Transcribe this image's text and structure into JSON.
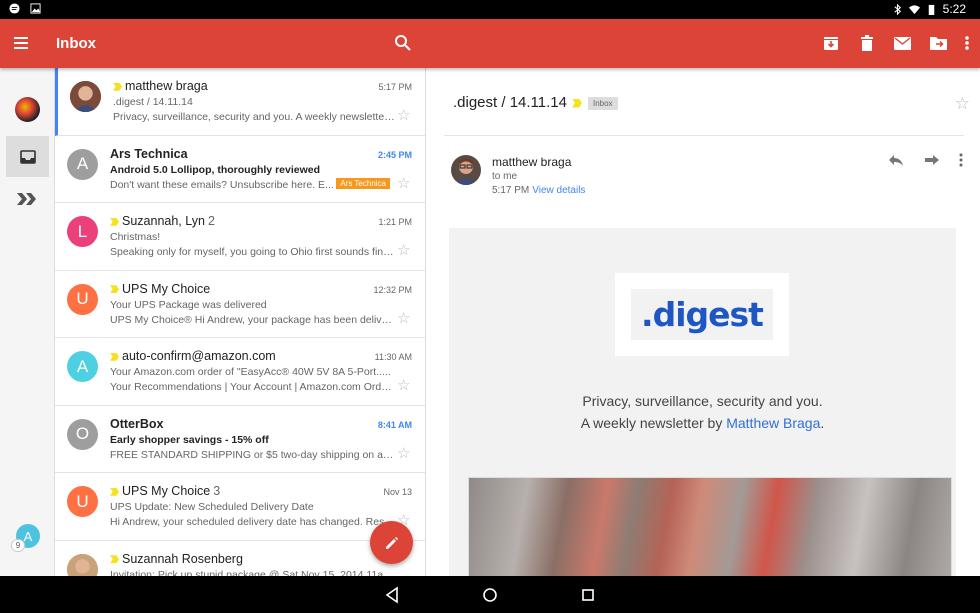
{
  "status_bar": {
    "time": "5:22"
  },
  "app_bar": {
    "title": "Inbox"
  },
  "messages": [
    {
      "sender": "matthew braga",
      "count": "",
      "important": true,
      "time": "5:17 PM",
      "time_bold": false,
      "subject": ".digest / 14.11.14",
      "snippet": "Privacy, surveillance, security and you. A weekly newsletter b...",
      "unread": false,
      "selected": true,
      "avatar_letter": "",
      "avatar_color": "#7a4a3a",
      "label": ""
    },
    {
      "sender": "Ars Technica",
      "count": "",
      "important": false,
      "time": "2:45 PM",
      "time_bold": true,
      "subject": "Android 5.0 Lollipop, thoroughly reviewed",
      "snippet": "Don't want these emails? Unsubscribe here. E...",
      "unread": true,
      "selected": false,
      "avatar_letter": "A",
      "avatar_color": "#9e9e9e",
      "label": "Ars Technica"
    },
    {
      "sender": "Suzannah, Lyn",
      "count": "2",
      "important": true,
      "time": "1:21 PM",
      "time_bold": false,
      "subject": "Christmas!",
      "snippet": "Speaking only for myself, you going to Ohio first sounds fine...",
      "unread": false,
      "selected": false,
      "avatar_letter": "L",
      "avatar_color": "#ec407a",
      "label": ""
    },
    {
      "sender": "UPS My Choice",
      "count": "",
      "important": true,
      "time": "12:32 PM",
      "time_bold": false,
      "subject": "Your UPS Package was delivered",
      "snippet": "UPS My Choice® Hi Andrew, your package has been deliver...",
      "unread": false,
      "selected": false,
      "avatar_letter": "U",
      "avatar_color": "#ff7043",
      "label": ""
    },
    {
      "sender": "auto-confirm@amazon.com",
      "count": "",
      "important": true,
      "time": "11:30 AM",
      "time_bold": false,
      "subject": "Your Amazon.com order of \"EasyAcc® 40W 5V 8A 5-Port.....",
      "snippet": "Your Recommendations | Your Account | Amazon.com Orde...",
      "unread": false,
      "selected": false,
      "avatar_letter": "A",
      "avatar_color": "#4dd0e1",
      "label": ""
    },
    {
      "sender": "OtterBox",
      "count": "",
      "important": false,
      "time": "8:41 AM",
      "time_bold": true,
      "subject": "Early shopper savings - 15% off",
      "snippet": "FREE STANDARD SHIPPING or $5 two-day shipping on all o...",
      "unread": true,
      "selected": false,
      "avatar_letter": "O",
      "avatar_color": "#9e9e9e",
      "label": ""
    },
    {
      "sender": "UPS My Choice",
      "count": "3",
      "important": true,
      "time": "Nov 13",
      "time_bold": false,
      "subject": "UPS Update: New Scheduled Delivery Date",
      "snippet": "Hi Andrew, your scheduled delivery date has changed. Resc...",
      "unread": false,
      "selected": false,
      "avatar_letter": "U",
      "avatar_color": "#ff7043",
      "label": ""
    },
    {
      "sender": "Suzannah Rosenberg",
      "count": "",
      "important": true,
      "time": "",
      "time_bold": false,
      "subject": "Invitation: Pick up stupid package @ Sat Nov 15, 2014 11a...",
      "snippet": "",
      "unread": false,
      "selected": false,
      "avatar_letter": "",
      "avatar_color": "#c9a27a",
      "label": ""
    }
  ],
  "reading_pane": {
    "subject": ".digest / 14.11.14",
    "label": "Inbox",
    "from": "matthew braga",
    "to": "to me",
    "time": "5:17 PM",
    "view_details": "View details",
    "logo_text": ".digest",
    "tagline_line1": "Privacy, surveillance, security and you.",
    "tagline_prefix": "A weekly newsletter by ",
    "tagline_link": "Matthew Braga",
    "tagline_suffix": "."
  },
  "rail": {
    "account_letter": "A",
    "account_badge": "9"
  },
  "colors": {
    "accent": "#db4437",
    "selected": "#4285f4",
    "label_orange": "#f7981d"
  }
}
